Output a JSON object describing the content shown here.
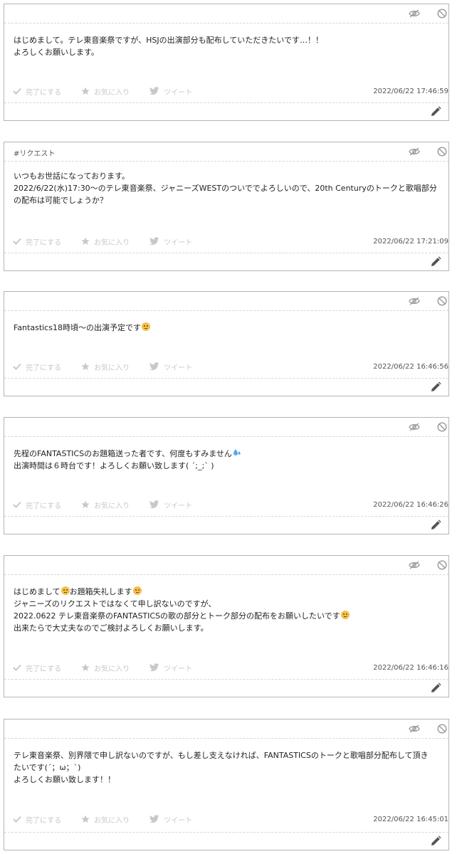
{
  "actions": {
    "complete": "完了にする",
    "favorite": "お気に入り",
    "tweet": "ツイート"
  },
  "icons": {
    "hide": "eye-slash-icon",
    "block": "ban-icon",
    "complete": "check-icon",
    "favorite": "star-icon",
    "tweet": "twitter-bird-icon",
    "edit": "pencil-icon",
    "emoji": "grimacing-face-emoji",
    "sweat": "sweat-droplets-emoji"
  },
  "colors": {
    "border": "#b5b5b5",
    "muted_text": "#c8c8c8",
    "icon_gray": "#9a9a9a"
  },
  "messages": [
    {
      "tag": "",
      "lines": [
        "はじめまして。テレ東音楽祭ですが、HSJの出演部分も配布していただきたいです…！！",
        "よろしくお願いします。"
      ],
      "timestamp": "2022/06/22 17:46:59"
    },
    {
      "tag": "#リクエスト",
      "lines": [
        "いつもお世話になっております。",
        "2022/6/22(水)17:30〜のテレ東音楽祭、ジャニーズWESTのついででよろしいので、20th Centuryのトークと歌唱部分",
        "の配布は可能でしょうか？"
      ],
      "timestamp": "2022/06/22 17:21:09"
    },
    {
      "tag": "",
      "lines": [
        "Fantastics18時頃〜の出演予定です"
      ],
      "timestamp": "2022/06/22 16:46:56"
    },
    {
      "tag": "",
      "lines": [
        "先程のFANTASTICSのお題箱送った者です、何度もすみません",
        "出演時間は６時台です！よろしくお願い致します( ´;_;` )"
      ],
      "timestamp": "2022/06/22 16:46:26"
    },
    {
      "tag": "",
      "lines": [
        "はじめまして",
        "お題箱失礼します",
        "ジャニーズのリクエストではなくて申し訳ないのですが、",
        "2022.0622 テレ東音楽祭のFANTASTICSの歌の部分とトーク部分の配布をお願いしたいです",
        "出来たらで大丈夫なのでご検討よろしくお願いします。"
      ],
      "timestamp": "2022/06/22 16:46:16"
    },
    {
      "tag": "",
      "lines": [
        "テレ東音楽祭、別界隈で申し訳ないのですが、もし差し支えなければ、FANTASTICSのトークと歌唱部分配布して頂き",
        "たいです(´；ω；`)",
        "よろしくお願い致します！！"
      ],
      "timestamp": "2022/06/22 16:45:01"
    }
  ]
}
